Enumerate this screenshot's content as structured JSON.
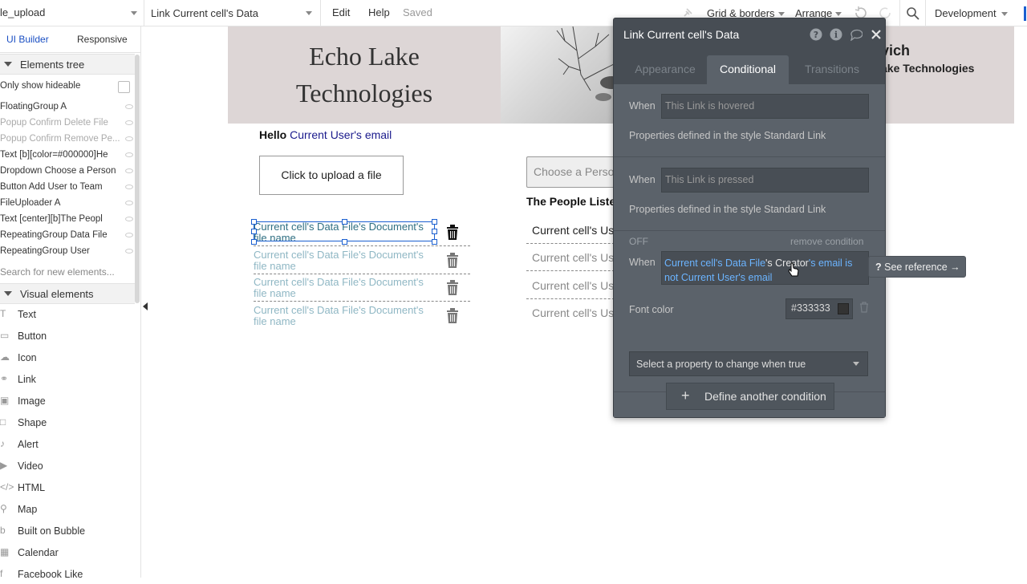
{
  "topbar": {
    "page_name": "le_upload",
    "element_name": "Link Current cell's Data",
    "menu_edit": "Edit",
    "menu_help": "Help",
    "saved": "Saved",
    "grid_borders": "Grid & borders",
    "arrange": "Arrange",
    "environment": "Development"
  },
  "sidebar": {
    "tab_ui_builder": "UI Builder",
    "tab_responsive": "Responsive",
    "elements_tree_title": "Elements tree",
    "only_show_hideable": "Only show hideable",
    "tree_items": [
      {
        "label": "FloatingGroup A",
        "dim": false
      },
      {
        "label": "Popup Confirm Delete File",
        "dim": true
      },
      {
        "label": "Popup Confirm Remove Pe...",
        "dim": true
      },
      {
        "label": "Text [b][color=#000000]He",
        "dim": false
      },
      {
        "label": "Dropdown Choose a Person",
        "dim": false
      },
      {
        "label": "Button Add User to Team",
        "dim": false
      },
      {
        "label": "FileUploader A",
        "dim": false
      },
      {
        "label": "Text [center][b]The Peopl",
        "dim": false
      },
      {
        "label": "RepeatingGroup Data File",
        "dim": false
      },
      {
        "label": "RepeatingGroup User",
        "dim": false
      }
    ],
    "search_placeholder": "Search for new elements...",
    "visual_elements_title": "Visual elements",
    "visual_elements": [
      {
        "label": "Text",
        "icon": "text-icon",
        "glyph": "T"
      },
      {
        "label": "Button",
        "icon": "button-icon",
        "glyph": "▭"
      },
      {
        "label": "Icon",
        "icon": "icon-icon",
        "glyph": "☁"
      },
      {
        "label": "Link",
        "icon": "link-icon",
        "glyph": "⚭"
      },
      {
        "label": "Image",
        "icon": "image-icon",
        "glyph": "▣"
      },
      {
        "label": "Shape",
        "icon": "shape-icon",
        "glyph": "□"
      },
      {
        "label": "Alert",
        "icon": "bell-icon",
        "glyph": "♪"
      },
      {
        "label": "Video",
        "icon": "video-icon",
        "glyph": "▶"
      },
      {
        "label": "HTML",
        "icon": "code-icon",
        "glyph": "</>"
      },
      {
        "label": "Map",
        "icon": "map-pin-icon",
        "glyph": "⚲"
      },
      {
        "label": "Built on Bubble",
        "icon": "bubble-icon",
        "glyph": "b"
      },
      {
        "label": "Calendar",
        "icon": "calendar-icon",
        "glyph": "▦"
      },
      {
        "label": "Facebook Like",
        "icon": "facebook-icon",
        "glyph": "f"
      }
    ]
  },
  "canvas": {
    "brand_line1": "Echo Lake",
    "brand_line2": "Technologies",
    "header_right_1": "vich",
    "header_right_2": "ake Technologies",
    "hello_label": "Hello",
    "hello_value": "Current User's email",
    "upload_button": "Click to upload a file",
    "file_rows": [
      "Current cell's Data File's Document's file name",
      "Current cell's Data File's Document's file name",
      "Current cell's Data File's Document's file name",
      "Current cell's Data File's Document's file name"
    ],
    "dropdown_placeholder": "Choose a Person",
    "people_title": "The People Listed",
    "user_rows": [
      "Current cell's Us",
      "Current cell's Us",
      "Current cell's Us",
      "Current cell's Us"
    ]
  },
  "editor": {
    "title": "Link Current cell's Data",
    "tabs": [
      "Appearance",
      "Conditional",
      "Transitions"
    ],
    "active_tab": "Conditional",
    "conditions": [
      {
        "when_label": "When",
        "expression": "This Link is hovered",
        "note": "Properties defined in the style Standard Link"
      },
      {
        "when_label": "When",
        "expression": "This Link is pressed",
        "note": "Properties defined in the style Standard Link"
      }
    ],
    "third": {
      "off_label": "OFF",
      "remove_label": "remove condition",
      "when_label": "When",
      "expr_part1": "Current cell's Data File",
      "expr_part2": "'s Creator",
      "expr_part3": "'s email is",
      "expr_part4": "not Current User's email",
      "property_label": "Font color",
      "property_value": "#333333",
      "swatch_color": "#333333",
      "select_placeholder": "Select a property to change when true"
    },
    "define_button": "Define another condition",
    "see_reference": "See reference →"
  }
}
